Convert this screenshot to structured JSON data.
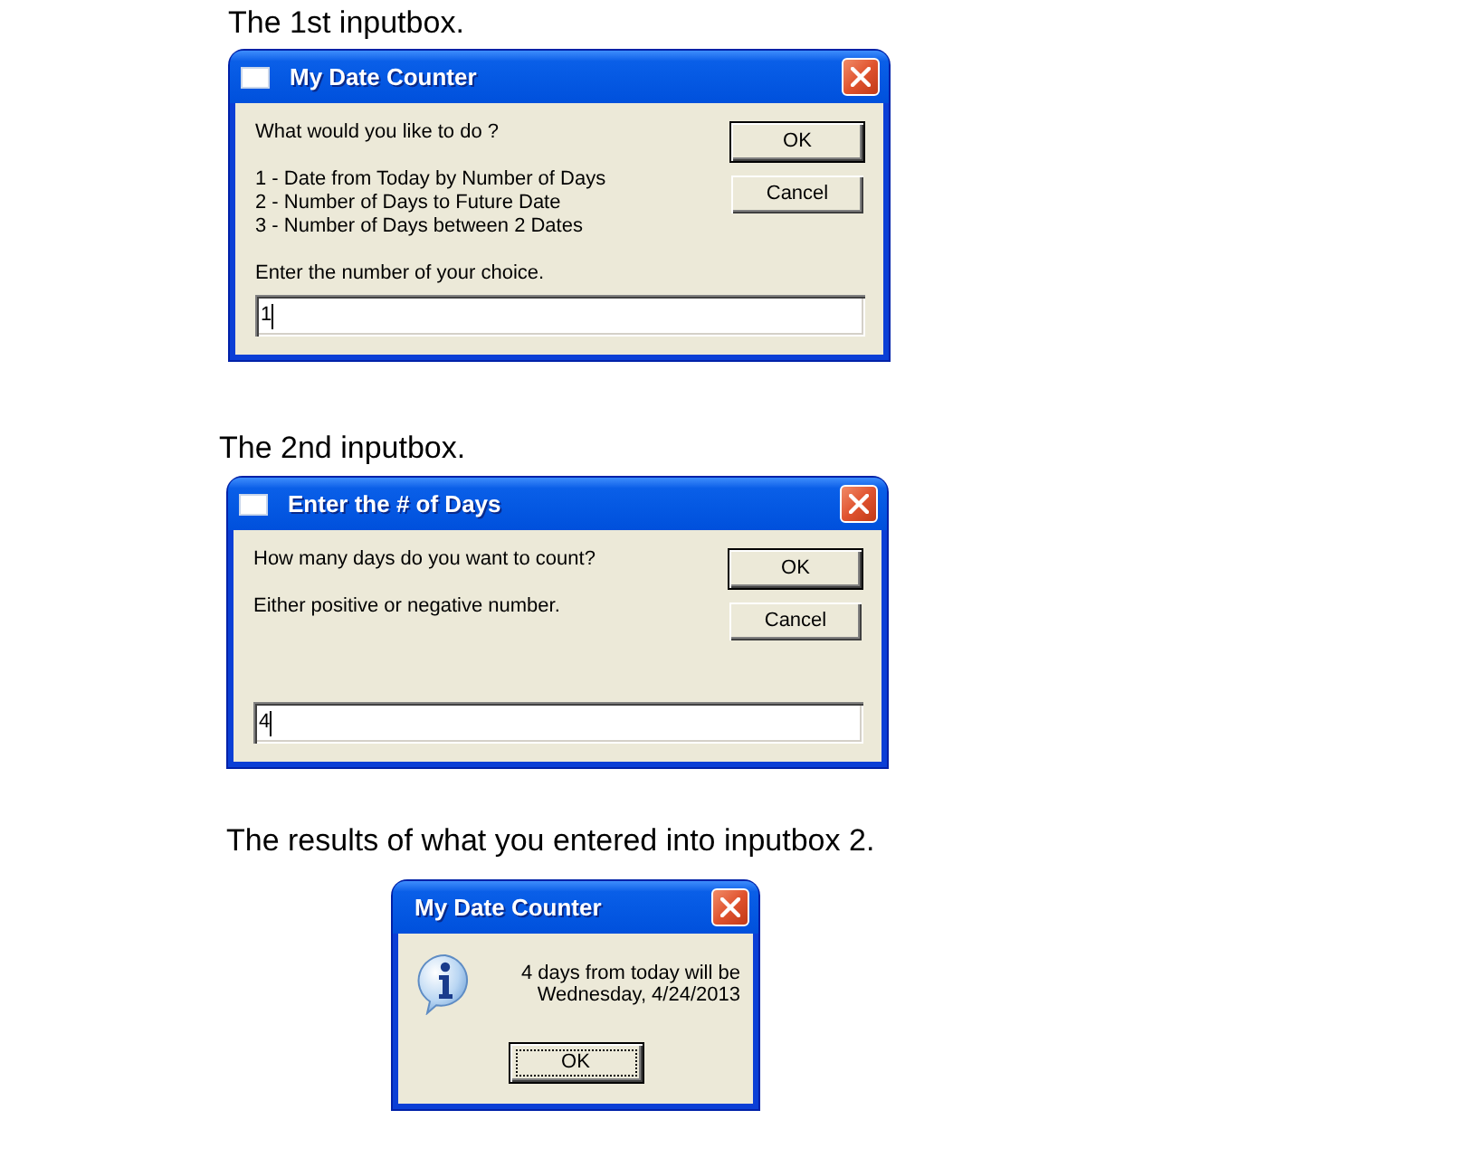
{
  "sections": [
    {
      "caption": "The 1st inputbox.",
      "dialog": {
        "kind": "inputbox",
        "title": "My Date Counter",
        "prompt_groups": [
          [
            "What would you like to do ?"
          ],
          [
            "1 - Date from Today by Number of Days",
            "2 - Number of Days to Future Date",
            "3 - Number of Days between 2 Dates"
          ],
          [
            "Enter the number of your choice."
          ]
        ],
        "buttons": [
          {
            "label": "OK",
            "default": true,
            "focused": false
          },
          {
            "label": "Cancel",
            "default": false,
            "focused": false
          }
        ],
        "input": {
          "value": "1",
          "focused": true
        }
      }
    },
    {
      "caption": "The 2nd inputbox.",
      "dialog": {
        "kind": "inputbox",
        "title": "Enter the # of Days",
        "prompt_groups": [
          [
            "How many days do you want to count?"
          ],
          [
            "Either positive or negative number."
          ]
        ],
        "buttons": [
          {
            "label": "OK",
            "default": true,
            "focused": false
          },
          {
            "label": "Cancel",
            "default": false,
            "focused": false
          }
        ],
        "input": {
          "value": "4",
          "focused": true
        }
      }
    },
    {
      "caption": "The results of what you entered into inputbox 2.",
      "dialog": {
        "kind": "message",
        "title": "My Date Counter",
        "message": [
          "4 days from today will be",
          "Wednesday, 4/24/2013"
        ],
        "buttons": [
          {
            "label": "OK",
            "default": true,
            "focused": true
          }
        ]
      }
    }
  ]
}
